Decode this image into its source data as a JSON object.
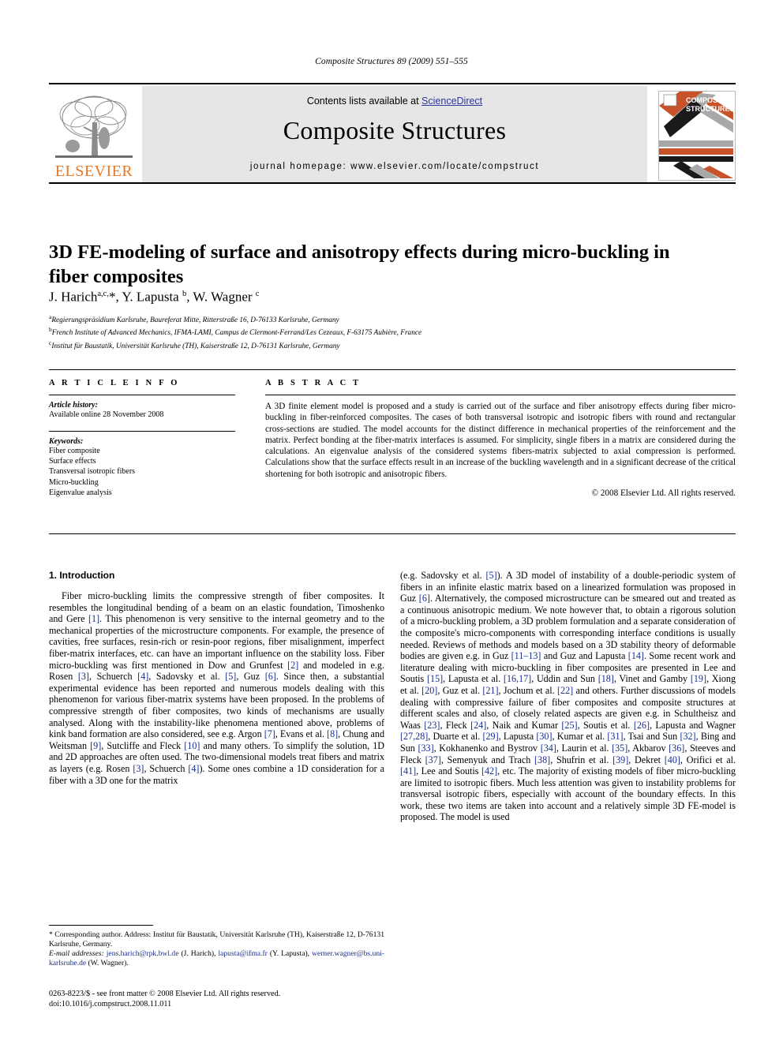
{
  "running_head": "Composite Structures 89 (2009) 551–555",
  "masthead": {
    "contents_prefix": "Contents lists available at ",
    "sciencedirect": "ScienceDirect",
    "journal_name": "Composite Structures",
    "homepage": "journal homepage: www.elsevier.com/locate/compstruct",
    "elsevier_wordmark": "ELSEVIER",
    "cover_title_line1": "COMPOSITE",
    "cover_title_line2": "STRUCTURES",
    "accent_orange": "#e87722",
    "link_blue": "#2b37a0",
    "band_gray": "#e6e6e6"
  },
  "article": {
    "title": "3D FE-modeling of surface and anisotropy effects during micro-buckling in fiber composites",
    "authors_html": "J. Harich<sup>a,c,</sup>*, Y. Lapusta <sup>b</sup>, W. Wagner <sup>c</sup>",
    "affiliations": [
      "Regierungspräsidium Karlsruhe, Baureferat Mitte, Ritterstraße 16, D-76133 Karlsruhe, Germany",
      "French Institute of Advanced Mechanics, IFMA-LAMI, Campus de Clermont-Ferrand/Les Cezeaux, F-63175 Aubière, France",
      "Institut für Baustatik, Universität Karlsruhe (TH), Kaiserstraße 12, D-76131 Karlsruhe, Germany"
    ],
    "affiliation_marks": [
      "a",
      "b",
      "c"
    ]
  },
  "info": {
    "heading": "A R T I C L E    I N F O",
    "history_label": "Article history:",
    "history_value": "Available online 28 November 2008",
    "keywords_label": "Keywords:",
    "keywords": [
      "Fiber composite",
      "Surface effects",
      "Transversal isotropic fibers",
      "Micro-buckling",
      "Eigenvalue analysis"
    ]
  },
  "abstract": {
    "heading": "A B S T R A C T",
    "text": "A 3D finite element model is proposed and a study is carried out of the surface and fiber anisotropy effects during fiber micro-buckling in fiber-reinforced composites. The cases of both transversal isotropic and isotropic fibers with round and rectangular cross-sections are studied. The model accounts for the distinct difference in mechanical properties of the reinforcement and the matrix. Perfect bonding at the fiber-matrix interfaces is assumed. For simplicity, single fibers in a matrix are considered during the calculations. An eigenvalue analysis of the considered systems fibers-matrix subjected to axial compression is performed. Calculations show that the surface effects result in an increase of the buckling wavelength and in a significant decrease of the critical shortening for both isotropic and anisotropic fibers.",
    "copyright": "© 2008 Elsevier Ltd. All rights reserved."
  },
  "section": {
    "intro_heading": "1. Introduction"
  },
  "intro": {
    "left_segments": [
      {
        "t": "Fiber micro-buckling limits the compressive strength of fiber composites. It resembles the longitudinal bending of a beam on an elastic foundation, Timoshenko and Gere "
      },
      {
        "t": "[1]",
        "ref": true
      },
      {
        "t": ". This phenomenon is very sensitive to the internal geometry and to the mechanical properties of the microstructure components. For example, the presence of cavities, free surfaces, resin-rich or resin-poor regions, fiber misalignment, imperfect fiber-matrix interfaces, etc. can have an important influence on the stability loss. Fiber micro-buckling was first mentioned in Dow and Grunfest "
      },
      {
        "t": "[2]",
        "ref": true
      },
      {
        "t": " and modeled in e.g. Rosen "
      },
      {
        "t": "[3]",
        "ref": true
      },
      {
        "t": ", Schuerch "
      },
      {
        "t": "[4]",
        "ref": true
      },
      {
        "t": ", Sadovsky et al. "
      },
      {
        "t": "[5]",
        "ref": true
      },
      {
        "t": ", Guz "
      },
      {
        "t": "[6]",
        "ref": true
      },
      {
        "t": ". Since then, a substantial experimental evidence has been reported and numerous models dealing with this phenomenon for various fiber-matrix systems have been proposed. In the problems of compressive strength of fiber composites, two kinds of mechanisms are usually analysed. Along with the instability-like phenomena mentioned above, problems of kink band formation are also considered, see e.g. Argon "
      },
      {
        "t": "[7]",
        "ref": true
      },
      {
        "t": ", Evans et al. "
      },
      {
        "t": "[8]",
        "ref": true
      },
      {
        "t": ", Chung and Weitsman "
      },
      {
        "t": "[9]",
        "ref": true
      },
      {
        "t": ", Sutcliffe and Fleck "
      },
      {
        "t": "[10]",
        "ref": true
      },
      {
        "t": " and many others. To simplify the solution, 1D and 2D approaches are often used. The two-dimensional models treat fibers and matrix as layers (e.g. Rosen "
      },
      {
        "t": "[3]",
        "ref": true
      },
      {
        "t": ", Schuerch "
      },
      {
        "t": "[4]",
        "ref": true
      },
      {
        "t": "). Some ones combine a 1D consideration for a fiber with a 3D one for the matrix"
      }
    ],
    "right_segments": [
      {
        "t": "(e.g. Sadovsky et al. "
      },
      {
        "t": "[5]",
        "ref": true
      },
      {
        "t": "). A 3D model of instability of a double-periodic system of fibers in an infinite elastic matrix based on a linearized formulation was proposed in Guz "
      },
      {
        "t": "[6]",
        "ref": true
      },
      {
        "t": ". Alternatively, the composed microstructure can be smeared out and treated as a continuous anisotropic medium. We note however that, to obtain a rigorous solution of a micro-buckling problem, a 3D problem formulation and a separate consideration of the composite's micro-components with corresponding interface conditions is usually needed. Reviews of methods and models based on a 3D stability theory of deformable bodies are given e.g. in Guz "
      },
      {
        "t": "[11–13]",
        "ref": true
      },
      {
        "t": " and Guz and Lapusta "
      },
      {
        "t": "[14]",
        "ref": true
      },
      {
        "t": ". Some recent work and literature dealing with micro-buckling in fiber composites are presented in Lee and Soutis "
      },
      {
        "t": "[15]",
        "ref": true
      },
      {
        "t": ", Lapusta et al. "
      },
      {
        "t": "[16,17]",
        "ref": true
      },
      {
        "t": ", Uddin and Sun "
      },
      {
        "t": "[18]",
        "ref": true
      },
      {
        "t": ", Vinet and Gamby "
      },
      {
        "t": "[19]",
        "ref": true
      },
      {
        "t": ", Xiong et al. "
      },
      {
        "t": "[20]",
        "ref": true
      },
      {
        "t": ", Guz et al. "
      },
      {
        "t": "[21]",
        "ref": true
      },
      {
        "t": ", Jochum et al. "
      },
      {
        "t": "[22]",
        "ref": true
      },
      {
        "t": " and others. Further discussions of models dealing with compressive failure of fiber composites and composite structures at different scales and also, of closely related aspects are given e.g. in Schultheisz and Waas "
      },
      {
        "t": "[23]",
        "ref": true
      },
      {
        "t": ", Fleck "
      },
      {
        "t": "[24]",
        "ref": true
      },
      {
        "t": ", Naik and Kumar "
      },
      {
        "t": "[25]",
        "ref": true
      },
      {
        "t": ", Soutis et al. "
      },
      {
        "t": "[26]",
        "ref": true
      },
      {
        "t": ", Lapusta and Wagner "
      },
      {
        "t": "[27,28]",
        "ref": true
      },
      {
        "t": ", Duarte et al. "
      },
      {
        "t": "[29]",
        "ref": true
      },
      {
        "t": ", Lapusta "
      },
      {
        "t": "[30]",
        "ref": true
      },
      {
        "t": ", Kumar et al. "
      },
      {
        "t": "[31]",
        "ref": true
      },
      {
        "t": ", Tsai and Sun "
      },
      {
        "t": "[32]",
        "ref": true
      },
      {
        "t": ", Bing and Sun "
      },
      {
        "t": "[33]",
        "ref": true
      },
      {
        "t": ", Kokhanenko and Bystrov "
      },
      {
        "t": "[34]",
        "ref": true
      },
      {
        "t": ", Laurin et al. "
      },
      {
        "t": "[35]",
        "ref": true
      },
      {
        "t": ", Akbarov "
      },
      {
        "t": "[36]",
        "ref": true
      },
      {
        "t": ", Steeves and Fleck "
      },
      {
        "t": "[37]",
        "ref": true
      },
      {
        "t": ", Semenyuk and Trach "
      },
      {
        "t": "[38]",
        "ref": true
      },
      {
        "t": ", Shufrin et al. "
      },
      {
        "t": "[39]",
        "ref": true
      },
      {
        "t": ", Dekret "
      },
      {
        "t": "[40]",
        "ref": true
      },
      {
        "t": ", Orifici et al. "
      },
      {
        "t": "[41]",
        "ref": true
      },
      {
        "t": ", Lee and Soutis "
      },
      {
        "t": "[42]",
        "ref": true
      },
      {
        "t": ", etc. The majority of existing models of fiber micro-buckling are limited to isotropic fibers. Much less attention was given to instability problems for transversal isotropic fibers, especially with account of the boundary effects. In this work, these two items are taken into account and a relatively simple 3D FE-model is proposed. The model is used"
      }
    ]
  },
  "footnote": {
    "corresponding": "* Corresponding author. Address: Institut für Baustatik, Universität Karlsruhe (TH), Kaiserstraße 12, D-76131 Karlsruhe, Germany.",
    "email_label": "E-mail addresses:",
    "emails": [
      {
        "addr": "jens.harich@rpk.bwl.de",
        "name": " (J. Harich), "
      },
      {
        "addr": "lapusta@ifma.fr",
        "name": " (Y. Lapusta), "
      },
      {
        "addr": "werner.wagner@bs.uni-karlsruhe.de",
        "name": " (W. Wagner)."
      }
    ]
  },
  "imprint": {
    "issn_line": "0263-8223/$ - see front matter © 2008 Elsevier Ltd. All rights reserved.",
    "doi_line": "doi:10.1016/j.compstruct.2008.11.011"
  }
}
